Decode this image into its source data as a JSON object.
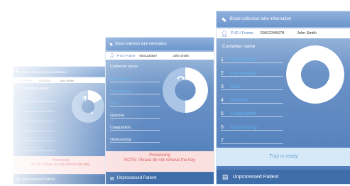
{
  "panels": {
    "left": {
      "title": "Blood collection tube information",
      "pid_label": "P-ID / Frame",
      "pid_value": "0001234...",
      "patient_name": "John Smith",
      "container_heading": "Container name",
      "items": [
        "Biochemical",
        "Immunology",
        "CBC",
        "Glucose",
        "Coagulation",
        "Outsourcing",
        ""
      ],
      "count": "1",
      "total": "6",
      "status": "Processing",
      "note": "NOTE: Please do not remove the tray",
      "bottom": "Unprocessed Patient"
    },
    "middle": {
      "title": "Blood collection tube information",
      "pid_label": "P-ID / Frame",
      "pid_value": "0001234567",
      "patient_name": "John Smith",
      "container_heading": "Container name",
      "items": [
        "Biochemical",
        "Immunology",
        "CBC",
        "Glucose",
        "Coagulation",
        "Outsourcing",
        ""
      ],
      "count": "3",
      "total": "6",
      "status": "Processing",
      "note": "NOTE: Please do not remove the tray",
      "bottom": "Unprocessed Patient"
    },
    "right": {
      "title": "Blood collection tube information",
      "pid_label": "P-ID / Frame",
      "pid_value": "00012345678",
      "patient_name": "John Smith",
      "container_heading": "Container name",
      "items": [
        "Biochemical",
        "Immunology",
        "CBC",
        "Glucose",
        "Coagulation",
        "Outsourcing",
        ""
      ],
      "count": "6",
      "total": "6",
      "status": "Tray is ready",
      "bottom": "Unprocessed Patient"
    }
  },
  "progress": {
    "left": 0.1667,
    "middle": 0.5,
    "right": 1.0
  },
  "colors": {
    "accent": "#4e7cc0",
    "item_text": "#63b2ee",
    "ready_bar": "#d6e9f8",
    "ready_text": "#6aa3d6",
    "processing_bar": "#fbe0e0",
    "processing_text": "#d85a5a"
  },
  "icons": {
    "title": "blood-tube-icon",
    "patient": "user-icon",
    "bottom": "list-icon",
    "ring": "tube-icon"
  }
}
